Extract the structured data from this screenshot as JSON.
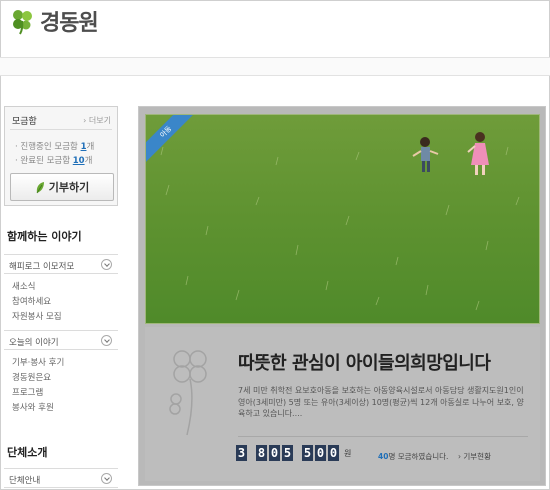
{
  "header": {
    "logo_text": "경동원"
  },
  "donate": {
    "title": "모금함",
    "more": "› 더보기",
    "ongoing_prefix": "· 진행중인 모금함 ",
    "ongoing_count": "1",
    "ongoing_suffix": "개",
    "done_prefix": "· 완료된 모금함 ",
    "done_count": "10",
    "done_suffix": "개",
    "button_label": "기부하기"
  },
  "sidebar": {
    "heading_story": "함께하는 이야기",
    "cat_happy": "해피로그 이모저모",
    "happy_items": [
      "새소식",
      "참여하세요",
      "자원봉사 모집"
    ],
    "cat_today": "오늘의 이야기",
    "today_items": [
      "기부·봉사 후기",
      "경동원은요",
      "프로그램",
      "봉사와 후원"
    ],
    "heading_org": "단체소개",
    "cat_org": "단체안내"
  },
  "banner": {
    "tag": "아동",
    "headline": "따뜻한 관심이 아이들의희망입니다",
    "description": "7세 미만 취학전 요보호아동을 보호하는 아동양육시설로서 아동담당 생활지도원1인이 영아(3세미만) 5명 또는 유아(3세이상) 10명(평균)씩 12개 아동실로 나누어 보호, 양육하고 있습니다....",
    "amount_digits": [
      "3",
      "8",
      "0",
      "5",
      "5",
      "0",
      "0"
    ],
    "amount_unit": "원",
    "people_count": "40",
    "people_suffix": "명 모금하였습니다.",
    "status_link": "› 기부현황"
  },
  "colors": {
    "accent_blue": "#1f6fb8",
    "counter_bg": "#2a3b57",
    "clover_green": "#6aa832"
  }
}
